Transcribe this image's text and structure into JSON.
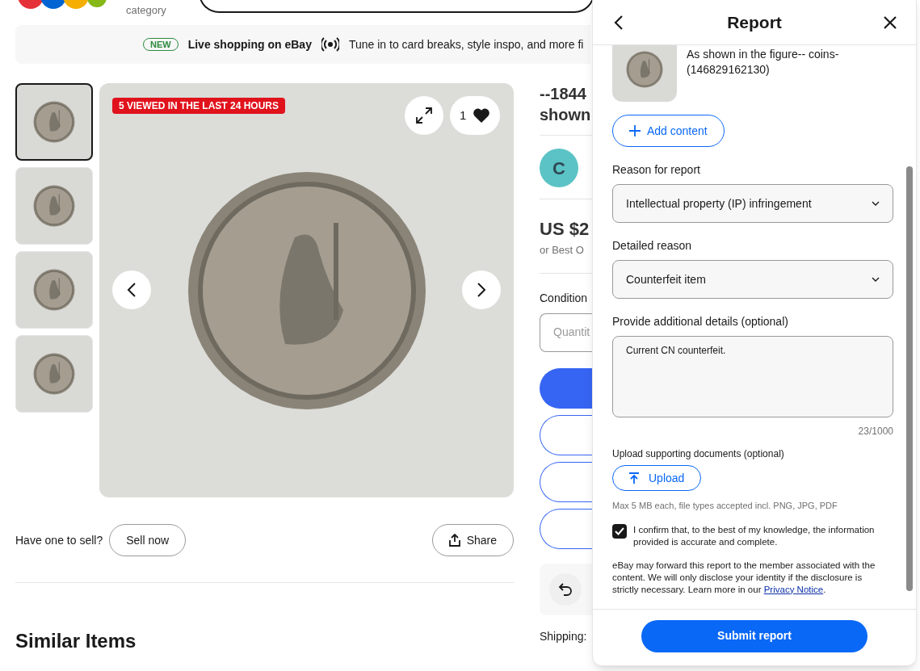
{
  "header": {
    "category_label": "category"
  },
  "banner": {
    "badge": "NEW",
    "title": "Live shopping on eBay",
    "text": "Tune in to card breaks, style inspo, and more fi"
  },
  "gallery": {
    "thumbnails": [
      {
        "selected": true
      },
      {
        "selected": false
      },
      {
        "selected": false
      },
      {
        "selected": false
      }
    ],
    "badge": "5 VIEWED IN THE LAST 24 HOURS",
    "likes": "1"
  },
  "sell": {
    "question": "Have one to sell?",
    "sell_button": "Sell now",
    "share_button": "Share"
  },
  "similar": {
    "title": "Similar Items"
  },
  "item_info": {
    "title_lines": [
      "--1844",
      "shown"
    ],
    "seller_initial": "C",
    "price": "US $2",
    "price_note": "or Best O",
    "condition_label": "Condition",
    "quantity_placeholder": "Quantit",
    "shipping_label": "Shipping:"
  },
  "report": {
    "title": "Report",
    "item_lines": [
      "As shown in the figure-- coins-",
      "(146829162130)"
    ],
    "add_content": "Add content",
    "reason_label": "Reason for report",
    "reason_value": "Intellectual property (IP) infringement",
    "detail_label": "Detailed reason",
    "detail_value": "Counterfeit item",
    "details_label": "Provide additional details (optional)",
    "details_value": "Current CN counterfeit.",
    "char_count": "23/1000",
    "upload_label": "Upload supporting documents (optional)",
    "upload_button": "Upload",
    "upload_hint": "Max 5 MB each, file types accepted incl. PNG, JPG, PDF",
    "confirm": {
      "checked": true,
      "text": "I confirm that, to the best of my knowledge, the information provided is accurate and complete."
    },
    "notice": "eBay may forward this report to the member associated with the content. We will only disclose your identity if the disclosure is strictly necessary. Learn more in our",
    "notice_link": "Privacy Notice",
    "notice_end": ".",
    "submit": "Submit report"
  }
}
